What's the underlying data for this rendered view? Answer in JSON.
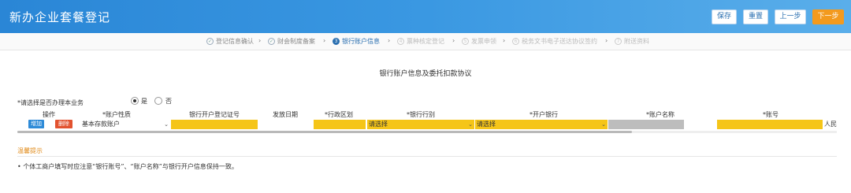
{
  "header": {
    "title": "新办企业套餐登记",
    "buttons": {
      "save": "保存",
      "reset": "重置",
      "prev": "上一步",
      "next": "下一步"
    }
  },
  "steps": [
    {
      "label": "登记信息确认",
      "state": "done"
    },
    {
      "label": "财会制度备案",
      "state": "done"
    },
    {
      "label": "银行账户信息",
      "state": "active",
      "number": "3"
    },
    {
      "label": "票种核定登记",
      "state": "pending",
      "number": "4"
    },
    {
      "label": "发票申领",
      "state": "pending",
      "number": "5"
    },
    {
      "label": "税务文书电子送达协议签约",
      "state": "pending",
      "number": "6"
    },
    {
      "label": "附送资料",
      "state": "pending",
      "number": "7"
    }
  ],
  "section": {
    "title": "银行账户信息及委托扣款协议"
  },
  "question": {
    "label": "*请选择是否办理本业务",
    "options": [
      "是",
      "否"
    ],
    "selected": "是"
  },
  "table": {
    "headers": {
      "op": "操作",
      "account_type": "*账户性质",
      "license_no": "银行开户登记证号",
      "issue_date": "发放日期",
      "district": "*行政区划",
      "bank_category": "*银行行别",
      "bank": "*开户银行",
      "account_name": "*账户名称",
      "account_no": "*账号"
    },
    "row": {
      "add_label": "增加",
      "delete_label": "删除",
      "account_type": "基本存款账户",
      "bank_category": "请选择",
      "bank": "请选择",
      "currency": "人民"
    }
  },
  "notice": {
    "title": "温馨提示",
    "text": "• 个体工商户填写时应注意“银行账号”、“账户名称”与银行开户信息保持一致。"
  },
  "colors": {
    "header": "#2a86d6",
    "accent": "#f39a1e",
    "required_field": "#f5c518",
    "add": "#2e8bd8",
    "delete": "#e2522f"
  }
}
